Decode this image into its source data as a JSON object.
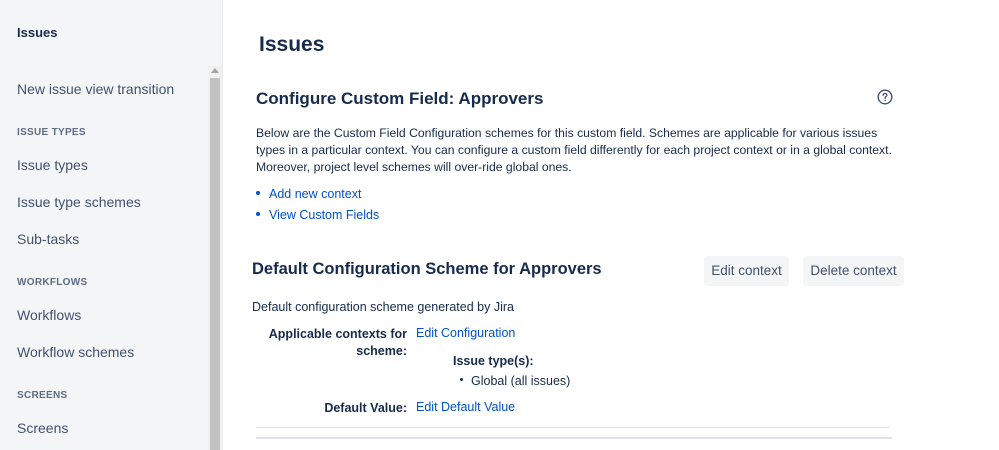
{
  "sidebar": {
    "header": "Issues",
    "items": [
      {
        "type": "item",
        "label": "New issue view transition"
      },
      {
        "type": "section",
        "label": "ISSUE TYPES"
      },
      {
        "type": "item",
        "label": "Issue types"
      },
      {
        "type": "item",
        "label": "Issue type schemes"
      },
      {
        "type": "item",
        "label": "Sub-tasks"
      },
      {
        "type": "section",
        "label": "WORKFLOWS"
      },
      {
        "type": "item",
        "label": "Workflows"
      },
      {
        "type": "item",
        "label": "Workflow schemes"
      },
      {
        "type": "section",
        "label": "SCREENS"
      },
      {
        "type": "item",
        "label": "Screens"
      }
    ]
  },
  "main": {
    "page_title": "Issues",
    "section_title": "Configure Custom Field: Approvers",
    "help_icon": "question-circle-icon",
    "description": "Below are the Custom Field Configuration schemes for this custom field. Schemes are applicable for various issues types in a particular context. You can configure a custom field differently for each project context or in a global context. Moreover, project level schemes will over-ride global ones.",
    "links": [
      "Add new context",
      "View Custom Fields"
    ],
    "scheme": {
      "title": "Default Configuration Scheme for Approvers",
      "edit_context_label": "Edit context",
      "delete_context_label": "Delete context",
      "description": "Default configuration scheme generated by Jira",
      "applicable_contexts_label": "Applicable contexts for scheme:",
      "edit_configuration_link": "Edit Configuration",
      "issue_types_label": "Issue type(s):",
      "issue_types": [
        "Global (all issues)"
      ],
      "default_value_label": "Default Value:",
      "edit_default_value_link": "Edit Default Value"
    }
  },
  "colors": {
    "link": "#0052cc",
    "text": "#172b4d",
    "sidebar_bg": "#f4f5f7",
    "button_bg": "#f4f5f7"
  }
}
